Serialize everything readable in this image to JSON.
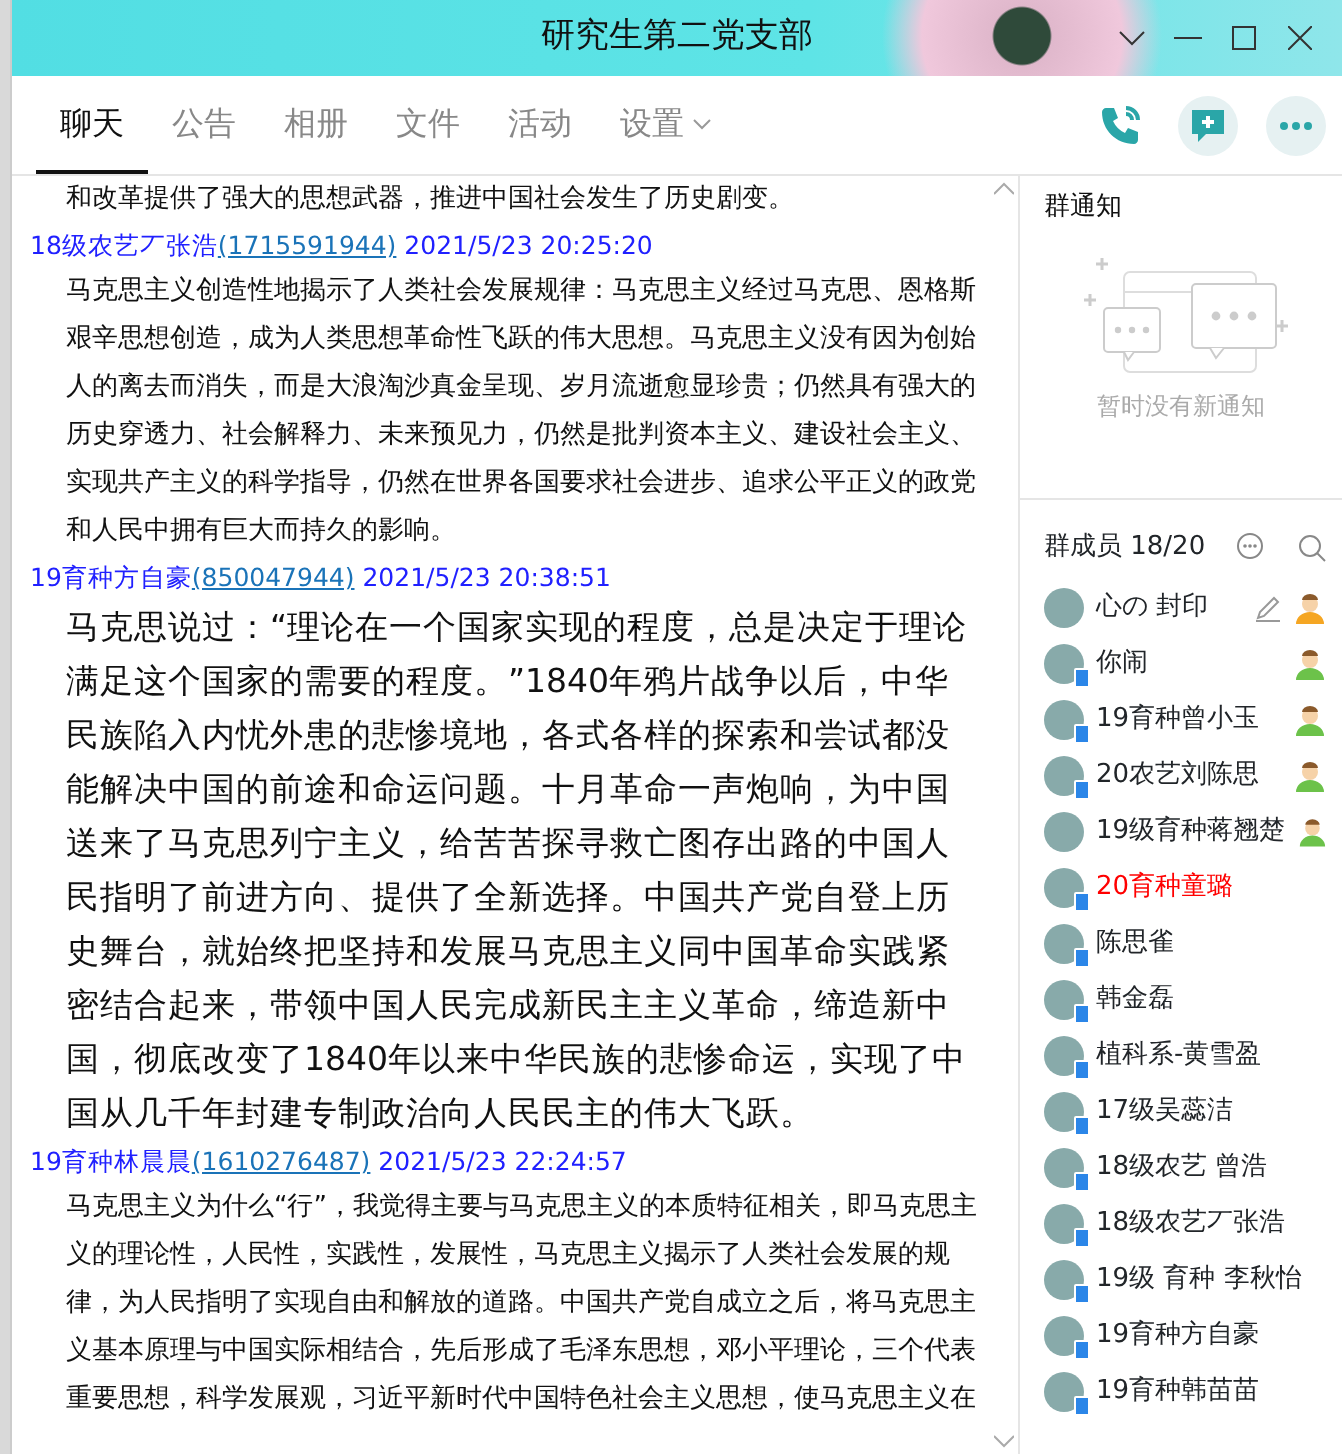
{
  "window": {
    "title": "研究生第二党支部"
  },
  "tabs": [
    {
      "label": "聊天",
      "selected": true,
      "dropdown": false
    },
    {
      "label": "公告",
      "selected": false,
      "dropdown": false
    },
    {
      "label": "相册",
      "selected": false,
      "dropdown": false
    },
    {
      "label": "文件",
      "selected": false,
      "dropdown": false
    },
    {
      "label": "活动",
      "selected": false,
      "dropdown": false
    },
    {
      "label": "设置",
      "selected": false,
      "dropdown": true
    }
  ],
  "messages": [
    {
      "kind": "normal",
      "body": "和改革提供了强大的思想武器，推进中国社会发生了历史剧变。"
    },
    {
      "kind": "normal",
      "sender": "18级农艺丆张浩",
      "account": "(1715591944)",
      "time": "2021/5/23 20:25:20",
      "body": "马克思主义创造性地揭示了人类社会发展规律：马克思主义经过马克思、恩格斯艰辛思想创造，成为人类思想革命性飞跃的伟大思想。马克思主义没有因为创始人的离去而消失，而是大浪淘沙真金呈现、岁月流逝愈显珍贵；仍然具有强大的历史穿透力、社会解释力、未来预见力，仍然是批判资本主义、建设社会主义、实现共产主义的科学指导，仍然在世界各国要求社会进步、追求公平正义的政党和人民中拥有巨大而持久的影响。"
    },
    {
      "kind": "large",
      "sender": "19育种方自豪",
      "account": "(850047944)",
      "time": "2021/5/23 20:38:51",
      "body": "马克思说过：“理论在一个国家实现的程度，总是决定于理论满足这个国家的需要的程度。”1840年鸦片战争以后，中华民族陷入内忧外患的悲惨境地，各式各样的探索和尝试都没能解决中国的前途和命运问题。十月革命一声炮响，为中国送来了马克思列宁主义，给苦苦探寻救亡图存出路的中国人民指明了前进方向、提供了全新选择。中国共产党自登上历史舞台，就始终把坚持和发展马克思主义同中国革命实践紧密结合起来，带领中国人民完成新民主主义革命，缔造新中国，彻底改变了1840年以来中华民族的悲惨命运，实现了中国从几千年封建专制政治向人民民主的伟大飞跃。"
    },
    {
      "kind": "normal",
      "sender": "19育种林晨晨",
      "account": "(1610276487)",
      "time": "2021/5/23 22:24:57",
      "body": "马克思主义为什么“行”，我觉得主要与马克思主义的本质特征相关，即马克思主义的理论性，人民性，实践性，发展性，马克思主义揭示了人类社会发展的规律，为人民指明了实现自由和解放的道路。中国共产党自成立之后，将马克思主义基本原理与中国实际相结合，先后形成了毛泽东思想，邓小平理论，三个代表重要思想，科学发展观，习近平新时代中国特色社会主义思想，使马克思主义在"
    }
  ],
  "notice": {
    "title": "群通知",
    "empty_text": "暂时没有新通知"
  },
  "members": {
    "title": "群成员 18/20",
    "items": [
      {
        "name": "心の 封印",
        "kind": "owner",
        "mobile": false,
        "editable": true
      },
      {
        "name": "你闹",
        "kind": "admin",
        "mobile": true,
        "editable": false
      },
      {
        "name": "19育种曾小玉",
        "kind": "admin",
        "mobile": true,
        "editable": false
      },
      {
        "name": "20农艺刘陈思",
        "kind": "admin",
        "mobile": true,
        "editable": false
      },
      {
        "name": "19级育种蒋翘楚",
        "kind": "admin",
        "mobile": false,
        "editable": false
      },
      {
        "name": "20育种童璐",
        "kind": "member",
        "mobile": true,
        "editable": false,
        "color": "#ff0000"
      },
      {
        "name": "陈思雀",
        "kind": "member",
        "mobile": true,
        "editable": false
      },
      {
        "name": "韩金磊",
        "kind": "member",
        "mobile": true,
        "editable": false
      },
      {
        "name": "植科系-黄雪盈",
        "kind": "member",
        "mobile": true,
        "editable": false
      },
      {
        "name": "17级吴蕊洁",
        "kind": "member",
        "mobile": true,
        "editable": false
      },
      {
        "name": "18级农艺 曾浩",
        "kind": "member",
        "mobile": true,
        "editable": false
      },
      {
        "name": "18级农艺丆张浩",
        "kind": "member",
        "mobile": true,
        "editable": false
      },
      {
        "name": "19级 育种 李秋怡",
        "kind": "member",
        "mobile": true,
        "editable": false
      },
      {
        "name": "19育种方自豪",
        "kind": "member",
        "mobile": true,
        "editable": false
      },
      {
        "name": "19育种韩苗苗",
        "kind": "member",
        "mobile": true,
        "editable": false
      }
    ]
  }
}
